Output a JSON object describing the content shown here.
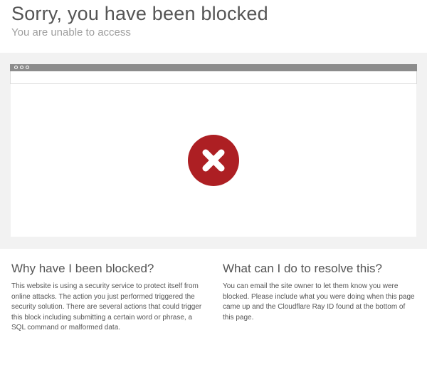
{
  "colors": {
    "error_red": "#ad1f23",
    "error_x": "#ffffff"
  },
  "header": {
    "title": "Sorry, you have been blocked",
    "subtitle": "You are unable to access"
  },
  "illustration": {
    "icon_name": "error-x-circle"
  },
  "left": {
    "heading": "Why have I been blocked?",
    "body": "This website is using a security service to protect itself from online attacks. The action you just performed triggered the security solution. There are several actions that could trigger this block including submitting a certain word or phrase, a SQL command or malformed data."
  },
  "right": {
    "heading": "What can I do to resolve this?",
    "body": "You can email the site owner to let them know you were blocked. Please include what you were doing when this page came up and the Cloudflare Ray ID found at the bottom of this page."
  }
}
